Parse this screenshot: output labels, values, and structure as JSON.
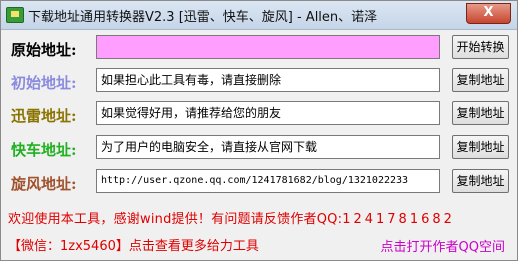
{
  "window": {
    "title": "下载地址通用转换器V2.3 [迅雷、快车、旋风] - Allen、诺泽",
    "close_symbol": "X"
  },
  "rows": [
    {
      "label": "原始地址:",
      "label_color": "#000000",
      "value": "",
      "button": "开始转换"
    },
    {
      "label": "初始地址:",
      "label_color": "#8a8adf",
      "value": "如果担心此工具有毒，请直接删除",
      "button": "复制地址"
    },
    {
      "label": "迅雷地址:",
      "label_color": "#8b7300",
      "value": "如果觉得好用，请推荐给您的朋友",
      "button": "复制地址"
    },
    {
      "label": "快车地址:",
      "label_color": "#20b020",
      "value": "为了用户的电脑安全，请直接从官网下载",
      "button": "复制地址"
    },
    {
      "label": "旋风地址:",
      "label_color": "#a0522d",
      "value": "http://user.qzone.qq.com/1241781682/blog/1321022233",
      "button": "复制地址"
    }
  ],
  "footer": {
    "welcome": "欢迎使用本工具，感谢wind提供！有问题请反馈作者QQ:",
    "qq": "1241781682",
    "wechat_link": "【微信：1zx5460】点击查看更多给力工具",
    "author_space_link": "点击打开作者QQ空间"
  },
  "colors": {
    "original_field_bg": "#ff9eff",
    "footer_red": "#e00000",
    "footer_magenta": "#cc00cc"
  }
}
